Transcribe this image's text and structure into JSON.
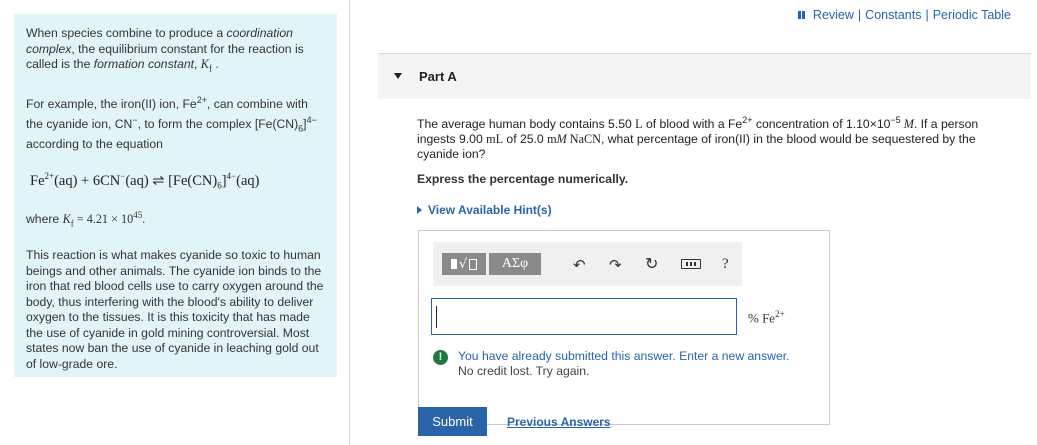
{
  "header": {
    "review": "Review",
    "constants": "Constants",
    "periodic_table": "Periodic Table",
    "separator": "|"
  },
  "sidebar": {
    "p1_a": "When species combine to produce a ",
    "p1_b": "coordination complex",
    "p1_c": ", the equilibrium constant for the reaction is called is the ",
    "p1_d": "formation constant",
    "p1_e": ", ",
    "kf": "K",
    "kf_sub": "f",
    "p1_end": " .",
    "p2_a": "For example, the iron(II) ion, Fe",
    "p2_fe_sup": "2+",
    "p2_b": ", can combine with the cyanide ion, CN",
    "p2_cn_sup": "−",
    "p2_c": ", to form the complex [Fe(CN)",
    "p2_complex_sub": "6",
    "p2_d": "]",
    "p2_complex_sup": "4−",
    "p2_e": " according to the equation",
    "eq_a": "Fe",
    "eq_fe_sup": "2+",
    "eq_b": "(aq) + 6CN",
    "eq_cn_sup": "−",
    "eq_c": "(aq) ⇌ [Fe(CN)",
    "eq_sub": "6",
    "eq_d": "]",
    "eq_sup": "4−",
    "eq_e": "(aq)",
    "p3_a": "where ",
    "p3_kf": "K",
    "p3_kf_sub": "f",
    "p3_b": " = 4.21 × 10",
    "p3_sup": "45",
    "p3_end": ".",
    "p4": "This reaction is what makes cyanide so toxic to human beings and other animals. The cyanide ion binds to the iron that red blood cells use to carry oxygen around the body, thus interfering with the blood's ability to deliver oxygen to the tissues. It is this toxicity that has made the use of cyanide in gold mining controversial. Most states now ban the use of cyanide in leaching gold out of low-grade ore."
  },
  "part": {
    "label": "Part A",
    "q_a": "The average human body contains 5.50 ",
    "q_L": "L",
    "q_b": " of blood with a Fe",
    "q_fe_sup": "2+",
    "q_c": " concentration of 1.10×10",
    "q_exp": "−5",
    "q_M": " M",
    "q_d": ". If a person ingests 9.00 ",
    "q_mL": "mL",
    "q_e": " of 25.0 ",
    "q_mM": "mM",
    "q_nacn": " NaCN",
    "q_f": ", what percentage of iron(II) in the blood would be sequestered by the cyanide ion?",
    "instruction": "Express the percentage numerically.",
    "hints": "View Available Hint(s)"
  },
  "answer": {
    "value": "",
    "units_a": "% Fe",
    "units_sup": "2+",
    "greek": "ΑΣφ",
    "help": "?",
    "warn_1": "You have already submitted this answer. Enter a new answer.",
    "warn_2": "No credit lost. Try again.",
    "submit": "Submit",
    "previous": "Previous Answers"
  }
}
